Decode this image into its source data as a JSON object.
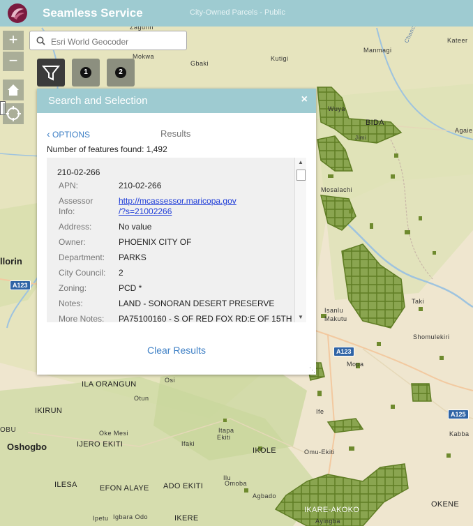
{
  "header": {
    "title": "Seamless Service",
    "subtitle": "City-Owned Parcels - Public"
  },
  "search": {
    "placeholder": "Esri World Geocoder",
    "value": ""
  },
  "toolbar": {
    "zoom_in": "+",
    "zoom_out": "−",
    "widget_1": "1",
    "widget_2": "2"
  },
  "panel": {
    "title": "Search and Selection",
    "close": "×",
    "options": "OPTIONS",
    "results_label": "Results",
    "feature_count": "Number of features found: 1,492",
    "clear_results": "Clear Results",
    "result": {
      "title": "210-02-266",
      "rows": [
        {
          "label": "APN:",
          "value": "210-02-266"
        },
        {
          "label": "Assessor",
          "label2": "Info:",
          "value": "http://mcassessor.maricopa.gov",
          "value2": "/?s=21002266"
        },
        {
          "label": "Address:",
          "value": "No value"
        },
        {
          "label": "Owner:",
          "value": "PHOENIX CITY OF"
        },
        {
          "label": "Department:",
          "value": "PARKS"
        },
        {
          "label": "City Council:",
          "value": "2"
        },
        {
          "label": "Zoning:",
          "value": "PCD *"
        },
        {
          "label": "Notes:",
          "value": "LAND - SONORAN DESERT PRESERVE"
        },
        {
          "label": "More Notes:",
          "value": "PA75100160 - S OF RED FOX RD:E OF 15TH"
        }
      ]
    }
  },
  "map_labels": {
    "zaguri": "Zagurin",
    "mokwa": "Mokwa",
    "gbaki": "Gbaki",
    "kutigi": "Kutigi",
    "manmagi": "Manmagi",
    "kategr": "Kateer",
    "wuya": "Wuya",
    "bida": "BIDA",
    "agaie": "Agaie",
    "mosalachi": "Mosalachi",
    "ilorin": "llorin",
    "taki": "Taki",
    "isanlu": "Isanlu",
    "makutu": "Makutu",
    "shomulekiri": "Shomulekiri",
    "mopa": "Mopa",
    "ila_orangun": "ILA ORANGUN",
    "osi": "Osi",
    "otun": "Otun",
    "ikirun": "IKIRUN",
    "oke_mesi": "Oke Mesi",
    "oshogbo": "Oshogbo",
    "ijero": "IJERO EKITI",
    "ifaki": "Ifaki",
    "ikole": "IKOLE",
    "omu_ekiti": "Omu-Ekiti",
    "ilesa": "ILESA",
    "efon": "EFON ALAYE",
    "ado": "ADO EKITI",
    "ikere": "IKERE",
    "okene": "OKENE",
    "kabba": "Kabba",
    "ife": "Ife",
    "itapa": "Itapa",
    "ekiti": "Ekiti",
    "omoba": "Omoba",
    "agbado": "Agbado",
    "ilu": "Ilu",
    "ipetu": "Ipetu",
    "igbara": "Igbara Odo",
    "ikare": "IKARE-AKOKO",
    "ayingba": "Ayingba",
    "obu": "OBU",
    "a123": "A123",
    "a125": "A125",
    "chanchaga": "Chanchaga",
    "jimi": "Jimi"
  },
  "colors": {
    "header": "#9ecbd1",
    "parcel": "#6e8a2e",
    "link": "#3d7fc5",
    "map_base": "#efe6cf"
  }
}
